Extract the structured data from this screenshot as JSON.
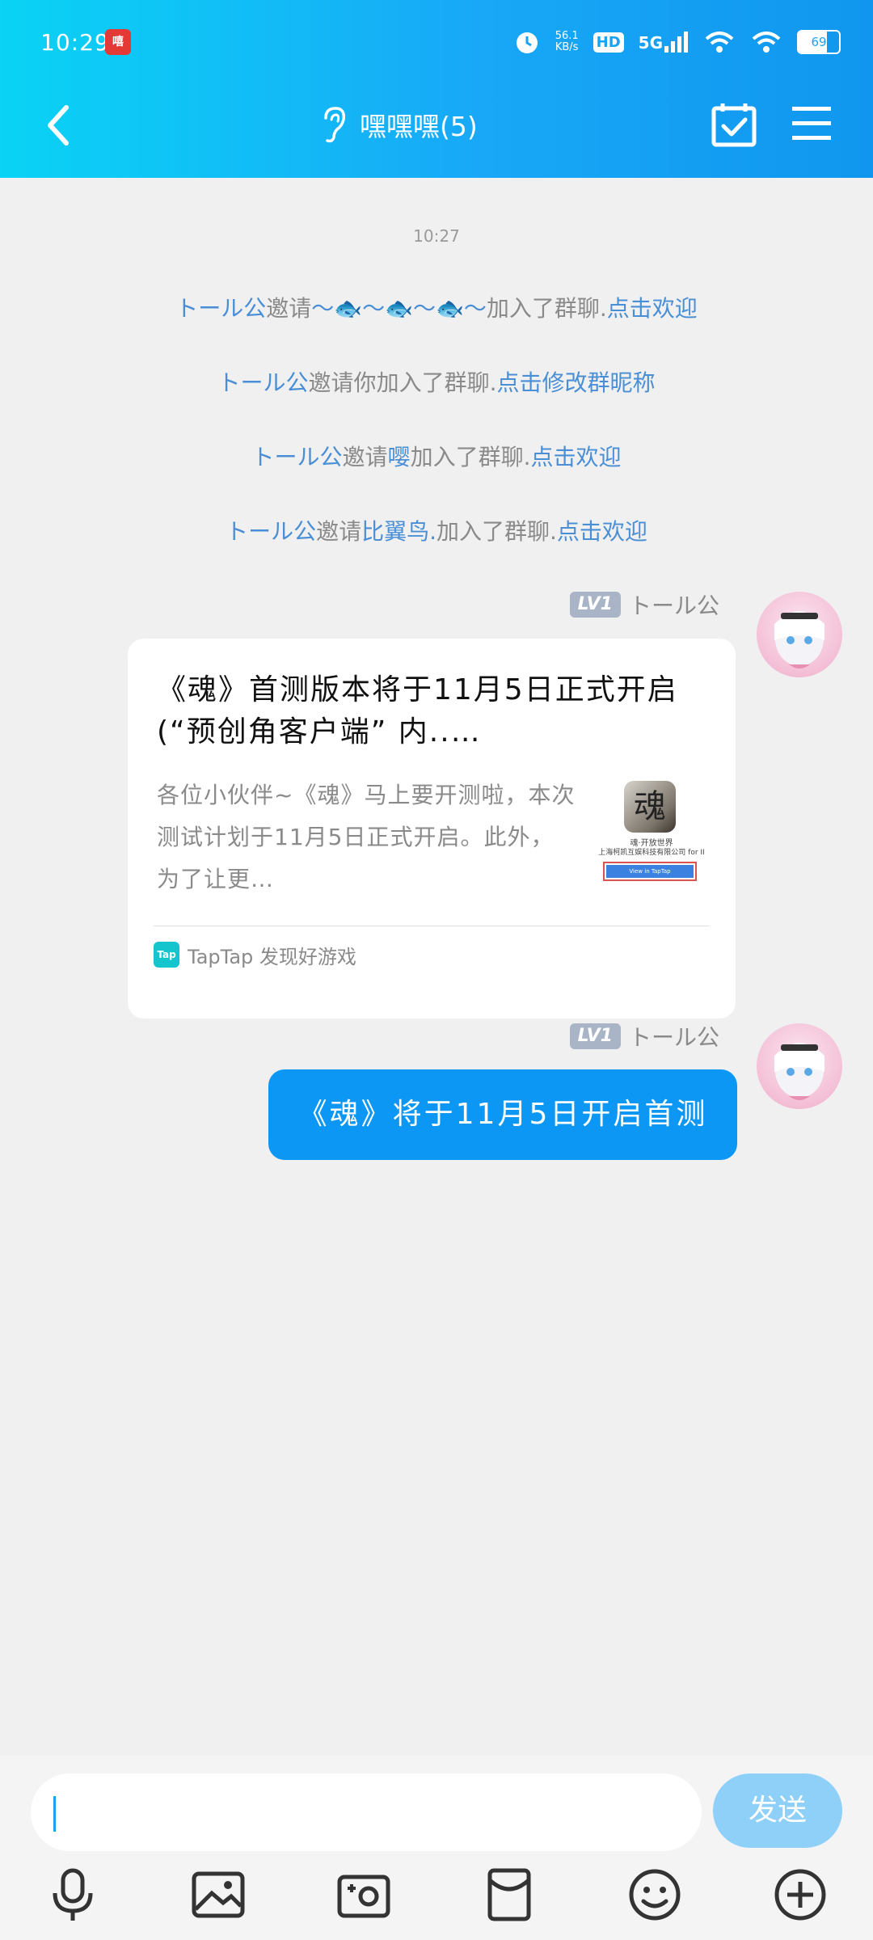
{
  "status_bar": {
    "time": "10:29",
    "app_badge": "嘻",
    "net_speed_value": "56.1",
    "net_speed_unit": "KB/s",
    "hd": "HD",
    "network": "5G",
    "battery": "69",
    "battery_level": 0.69
  },
  "header": {
    "title": "嘿嘿嘿(5)"
  },
  "chat": {
    "timestamp": "10:27",
    "system_messages": [
      {
        "inviter": "トール公",
        "verb": "邀请",
        "invitee": "〜🐟〜🐟〜🐟〜",
        "rest": "加入了群聊.",
        "action": "点击欢迎"
      },
      {
        "inviter": "トール公",
        "verb": "邀请",
        "invitee": "你",
        "rest": "加入了群聊.",
        "action": "点击修改群昵称"
      },
      {
        "inviter": "トール公",
        "verb": "邀请",
        "invitee": "嘤",
        "rest": "加入了群聊.",
        "action": "点击欢迎"
      },
      {
        "inviter": "トール公",
        "verb": "邀请",
        "invitee": "比翼鸟.",
        "rest": "加入了群聊.",
        "action": "点击欢迎"
      }
    ],
    "messages": [
      {
        "level": "LV1",
        "sender": "トール公",
        "card": {
          "title": "《魂》首测版本将于11月5日正式开启(“预创角客户端” 内..…",
          "description": "各位小伙伴~《魂》马上要开测啦，本次测试计划于11月5日正式开启。此外，为了让更…",
          "thumb_icon_char": "魂",
          "thumb_line1": "魂·开放世界",
          "thumb_line2": "上海柯凯互娱科技有限公司 for II",
          "thumb_button": "View in TapTap",
          "source": "TapTap 发现好游戏",
          "source_logo": "Tap"
        }
      },
      {
        "level": "LV1",
        "sender": "トール公",
        "text": "《魂》将于11月5日开启首测"
      }
    ]
  },
  "input_bar": {
    "placeholder": "",
    "send_label": "发送",
    "tools": [
      "microphone-icon",
      "image-icon",
      "camera-icon",
      "red-packet-icon",
      "emoji-icon",
      "plus-icon"
    ]
  },
  "colors": {
    "header_gradient_start": "#0ad3f5",
    "header_gradient_end": "#1096ee",
    "bubble": "#0c97f5",
    "link": "#4a8fd6",
    "send_button": "#8ed0f7"
  }
}
